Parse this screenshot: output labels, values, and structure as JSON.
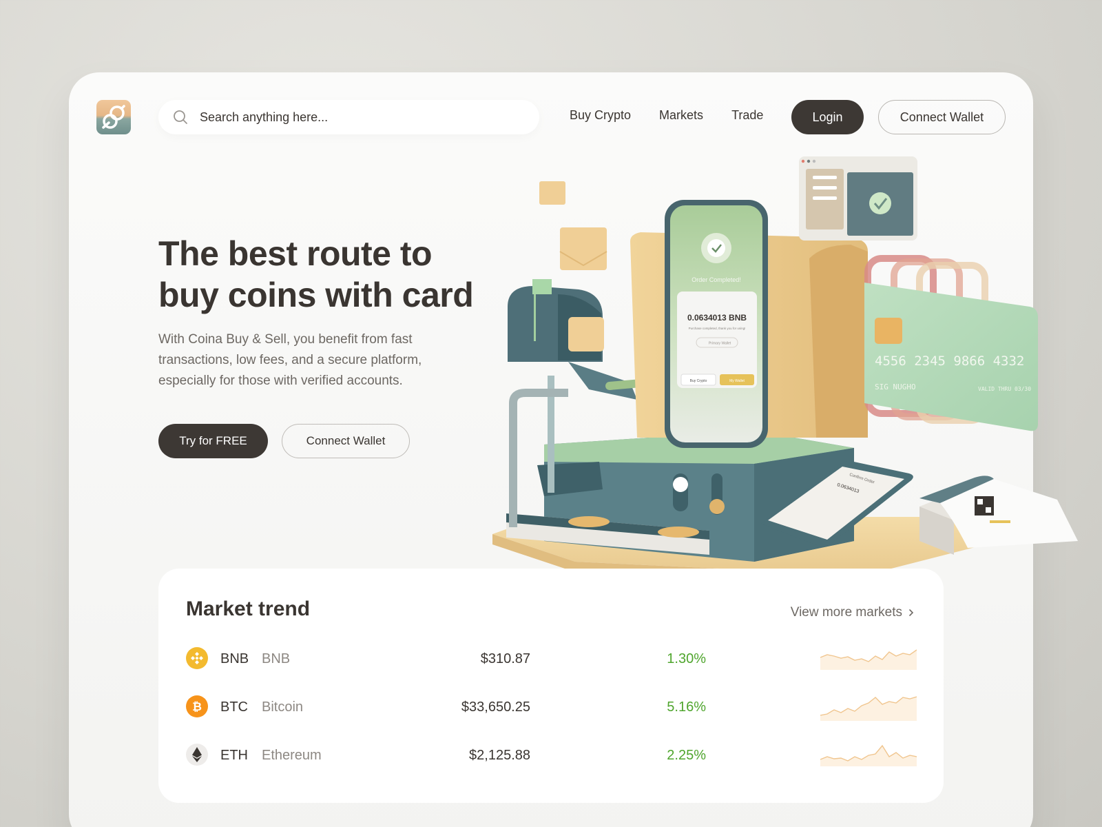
{
  "header": {
    "search_placeholder": "Search anything here...",
    "nav": [
      "Buy Crypto",
      "Markets",
      "Trade"
    ],
    "login_label": "Login",
    "connect_wallet_label": "Connect Wallet"
  },
  "hero": {
    "title": "The best route to buy coins with card",
    "description": "With Coina Buy & Sell, you benefit from fast transactions, low fees, and a secure platform, especially for those with verified accounts.",
    "try_label": "Try for FREE",
    "connect_wallet_label": "Connect Wallet"
  },
  "illustration": {
    "phone_status": "Order Completed!",
    "phone_amount": "0.0634013 BNB",
    "phone_subtext": "Purchase completed, thank you for using!",
    "phone_wallet": "Primary Wallet",
    "phone_btn_left": "Buy Crypto",
    "phone_btn_right": "My Wallet",
    "card_number": "4556 2345 9866 4332",
    "card_valid": "VALID THRU 03/30",
    "card_holder": "SIG NUGHO",
    "tablet_title": "Confirm Order",
    "tablet_amount": "0.0634013"
  },
  "market": {
    "title": "Market trend",
    "view_more": "View more markets",
    "rows": [
      {
        "symbol": "BNB",
        "name": "BNB",
        "price": "$310.87",
        "change": "1.30%",
        "icon": "bnb-icon",
        "color": "#f3ba2f"
      },
      {
        "symbol": "BTC",
        "name": "Bitcoin",
        "price": "$33,650.25",
        "change": "5.16%",
        "icon": "bitcoin-icon",
        "color": "#f7931a"
      },
      {
        "symbol": "ETH",
        "name": "Ethereum",
        "price": "$2,125.88",
        "change": "2.25%",
        "icon": "ethereum-icon",
        "color": "#3a3531"
      }
    ]
  },
  "colors": {
    "accent_dark": "#3d3834",
    "positive": "#4fa52d",
    "spark_line": "#f0c58e",
    "spark_fill": "#fdf1e1"
  }
}
